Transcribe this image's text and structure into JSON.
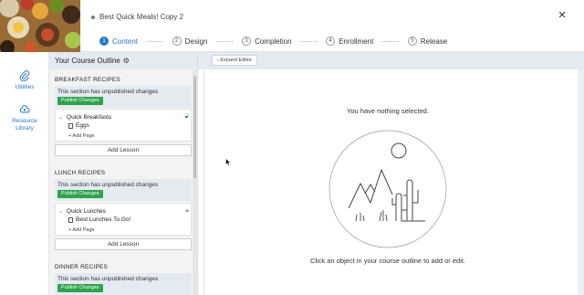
{
  "header": {
    "course_title": "Best Quick Meals! Copy 2",
    "close_glyph": "✕",
    "steps": [
      {
        "num": "1",
        "label": "Content",
        "active": true
      },
      {
        "num": "2",
        "label": "Design",
        "active": false
      },
      {
        "num": "3",
        "label": "Completion",
        "active": false
      },
      {
        "num": "4",
        "label": "Enrollment",
        "active": false
      },
      {
        "num": "5",
        "label": "Release",
        "active": false
      }
    ],
    "step_separator": "........"
  },
  "rail": {
    "utilities_label": "Utilities",
    "resource_label_1": "Resource",
    "resource_label_2": "Library"
  },
  "outline": {
    "title": "Your Course Outline",
    "sections": [
      {
        "name": "BREAKFAST RECIPES",
        "notice": "This section has unpublished changes",
        "publish_label": "Publish Changes",
        "lesson_title": "Quick Breakfasts",
        "lock_color": "green",
        "page_title": "Eggs",
        "add_page": "+  Add Page",
        "add_lesson": "Add Lesson"
      },
      {
        "name": "LUNCH RECIPES",
        "notice": "This section has unpublished changes",
        "publish_label": "Publish Changes",
        "lesson_title": "Quick Lunches",
        "lock_color": "gray",
        "page_title": "Best Lunches To Go!",
        "add_page": "+  Add Page",
        "add_lesson": "Add Lesson"
      },
      {
        "name": "DINNER RECIPES",
        "notice": "This section has unpublished changes",
        "publish_label": "Publish Changes"
      }
    ]
  },
  "main": {
    "expand_label": "Expand Editor",
    "nothing_selected": "You have nothing selected.",
    "instruction": "Click an object in your course outline to add or edit."
  },
  "colors": {
    "accent_blue": "#2b78c5",
    "publish_green": "#2ea34b",
    "panel_blue": "#e3eaf1"
  }
}
